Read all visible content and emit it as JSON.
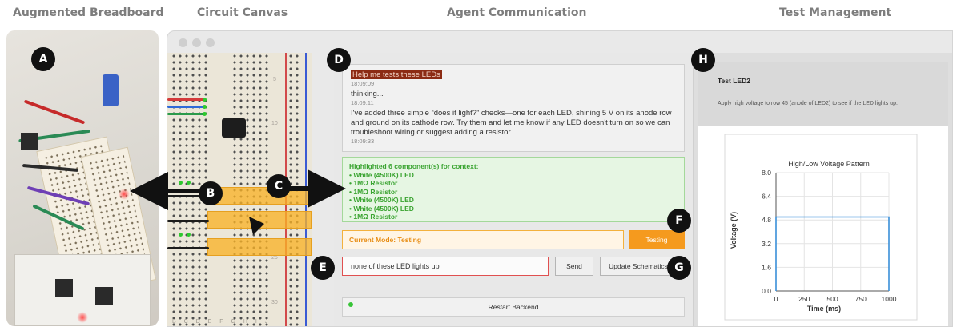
{
  "sections": {
    "breadboard": "Augmented Breadboard",
    "canvas": "Circuit Canvas",
    "agent": "Agent Communication",
    "tests": "Test Management"
  },
  "markers": [
    "A",
    "B",
    "C",
    "D",
    "E",
    "F",
    "G",
    "H"
  ],
  "canvas": {
    "row_numbers": [
      "5",
      "10",
      "25",
      "30"
    ],
    "column_labels": "B C D E   F G H I J"
  },
  "chat": {
    "messages": [
      {
        "text": "Help me tests these LEDs",
        "time": "18:09:09",
        "highlighted": true
      },
      {
        "text": "thinking...",
        "time": "18:09:11"
      },
      {
        "text": "I've added three simple “does it light?” checks—one for each LED, shining 5 V on its anode row and ground on its cathode row. Try them and let me know if any LED doesn't turn on so we can troubleshoot wiring or suggest adding a resistor.",
        "time": "18:09:33"
      }
    ]
  },
  "context": {
    "heading": "Highlighted 6 component(s) for context:",
    "items": [
      "• White (4500K) LED",
      "• 1MΩ Resistor",
      "• 1MΩ Resistor",
      "• White (4500K) LED",
      "• White (4500K) LED",
      "• 1MΩ Resistor"
    ]
  },
  "mode": {
    "label": "Current Mode: Testing",
    "button": "Testing"
  },
  "input": {
    "value": "none of these LED lights up"
  },
  "buttons": {
    "send": "Send",
    "update": "Update Schematics",
    "restart": "Restart Backend"
  },
  "test": {
    "title": "Test LED2",
    "description": "Apply high voltage to row 45 (anode of LED2) to see if the LED lights up."
  },
  "chart_data": {
    "type": "line",
    "title": "High/Low Voltage Pattern",
    "xlabel": "Time (ms)",
    "ylabel": "Voltage (V)",
    "x_ticks": [
      "0",
      "250",
      "500",
      "750",
      "1000"
    ],
    "y_ticks": [
      "0.0",
      "1.6",
      "3.2",
      "4.8",
      "6.4",
      "8.0"
    ],
    "xlim": [
      0,
      1000
    ],
    "ylim": [
      0,
      8
    ],
    "grid": true,
    "series": [
      {
        "x": [
          0,
          0,
          1000,
          1000
        ],
        "y": [
          0,
          5,
          5,
          0
        ]
      }
    ],
    "line_color": "#3a8fd9"
  }
}
